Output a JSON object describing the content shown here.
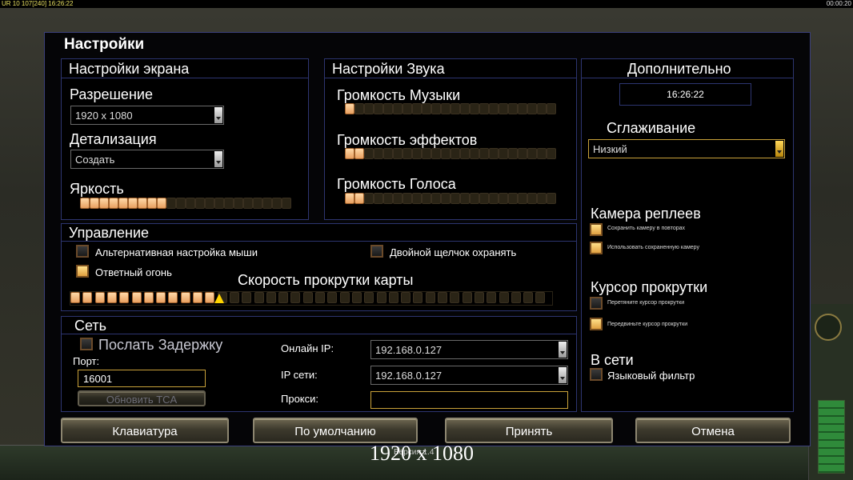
{
  "hud": {
    "top_left": "UR 10 107[240] 16:26:22",
    "top_right": "00:00:20"
  },
  "dialog": {
    "title": "Настройки"
  },
  "screen": {
    "title": "Настройки экрана",
    "resolution_label": "Разрешение",
    "resolution_value": "1920 x 1080",
    "detail_label": "Детализация",
    "detail_value": "Создать",
    "brightness_label": "Яркость",
    "brightness_level": 0.41
  },
  "sound": {
    "title": "Настройки Звука",
    "music_label": "Громкость Музыки",
    "music_level": 0.05,
    "effects_label": "Громкость эффектов",
    "effects_level": 0.1,
    "voice_label": "Громкость Голоса",
    "voice_level": 0.1
  },
  "extra": {
    "title": "Дополнительно",
    "clock": "16:26:22",
    "antialias_label": "Сглаживание",
    "antialias_value": "Низкий",
    "replay_camera_label": "Камера реплеев",
    "replay_save_camera": "Сохранить камеру в повторах",
    "replay_use_saved": "Использовать сохраненную камеру",
    "scroll_cursor_label": "Курсор прокрутки",
    "scroll_drag": "Перетяните курсор прокрутки",
    "scroll_move": "Передвиньте курсор прокрутки",
    "online_label": "В сети",
    "lang_filter": "Языковый фильтр"
  },
  "controls": {
    "title": "Управление",
    "alt_mouse": "Альтернативная настройка мыши",
    "double_click": "Двойной щелчок охранять",
    "return_fire": "Ответный огонь",
    "scroll_speed_label": "Скорость прокрутки карты",
    "scroll_speed_level": 0.32
  },
  "network": {
    "title": "Сеть",
    "send_delay": "Послать Задержку",
    "port_label": "Порт:",
    "port_value": "16001",
    "update_button": "Обновить TCA",
    "online_ip_label": "Онлайн IP:",
    "online_ip_value": "192.168.0.127",
    "lan_ip_label": "IP сети:",
    "lan_ip_value": "192.168.0.127",
    "proxy_label": "Прокси:",
    "proxy_value": ""
  },
  "buttons": {
    "keyboard": "Клавиатура",
    "defaults": "По умолчанию",
    "accept": "Принять",
    "cancel": "Отмена"
  },
  "overlay": {
    "resolution_text": "1920 x 1080",
    "version_text": "Версия 1.4"
  }
}
